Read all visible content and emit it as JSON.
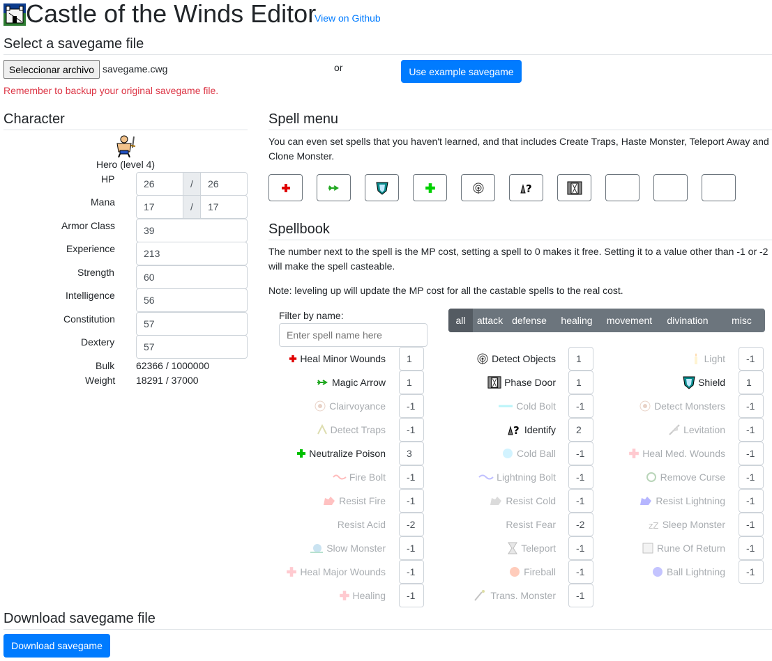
{
  "header": {
    "title": "Castle of the Winds Editor",
    "github_link": "View on Github"
  },
  "savegame": {
    "heading": "Select a savegame file",
    "choose_button": "Seleccionar archivo",
    "file_name": "savegame.cwg",
    "or_text": "or",
    "example_button": "Use example savegame",
    "warning": "Remember to backup your original savegame file."
  },
  "character": {
    "heading": "Character",
    "name": "Hero (level 4)",
    "hp_label": "HP",
    "hp_current": "26",
    "hp_max": "26",
    "mana_label": "Mana",
    "mana_current": "17",
    "mana_max": "17",
    "slash": "/",
    "armor_label": "Armor Class",
    "armor": "39",
    "experience_label": "Experience",
    "experience": "213",
    "strength_label": "Strength",
    "strength": "60",
    "intelligence_label": "Intelligence",
    "intelligence": "56",
    "constitution_label": "Constitution",
    "constitution": "57",
    "dexterity_label": "Dextery",
    "dexterity": "57",
    "bulk_label": "Bulk",
    "bulk": "62366 / 1000000",
    "weight_label": "Weight",
    "weight": "18291 / 37000"
  },
  "spell_menu": {
    "heading": "Spell menu",
    "desc": "You can even set spells that you haven't learned, and that includes Create Traps, Haste Monster, Teleport Away and Clone Monster.",
    "slots": [
      "heal-minor-icon",
      "magic-arrow-icon",
      "shield-icon",
      "neutralize-poison-icon",
      "detect-objects-icon",
      "identify-icon",
      "phase-door-icon",
      "",
      "",
      ""
    ]
  },
  "spellbook": {
    "heading": "Spellbook",
    "desc1": "The number next to the spell is the MP cost, setting a spell to 0 makes it free. Setting it to a value other than -1 or -2 will make the spell casteable.",
    "desc2": "Note: leveling up will update the MP cost for all the castable spells to the real cost.",
    "filter_label": "Filter by name:",
    "filter_placeholder": "Enter spell name here",
    "categories": [
      "all",
      "attack",
      "defense",
      "healing",
      "movement",
      "divination",
      "misc"
    ],
    "spells": [
      [
        {
          "name": "Heal Minor Wounds",
          "cost": "1",
          "learned": true,
          "icon": "red-cross-icon"
        },
        {
          "name": "Magic Arrow",
          "cost": "1",
          "learned": true,
          "icon": "magic-arrow-icon"
        },
        {
          "name": "Clairvoyance",
          "cost": "-1",
          "learned": false,
          "icon": "eye-icon"
        },
        {
          "name": "Detect Traps",
          "cost": "-1",
          "learned": false,
          "icon": "trap-icon"
        },
        {
          "name": "Neutralize Poison",
          "cost": "3",
          "learned": true,
          "icon": "green-cross-icon"
        },
        {
          "name": "Fire Bolt",
          "cost": "-1",
          "learned": false,
          "icon": "fire-bolt-icon"
        },
        {
          "name": "Resist Fire",
          "cost": "-1",
          "learned": false,
          "icon": "resist-fire-icon"
        },
        {
          "name": "Resist Acid",
          "cost": "-2",
          "learned": false,
          "icon": ""
        },
        {
          "name": "Slow Monster",
          "cost": "-1",
          "learned": false,
          "icon": "snail-icon"
        },
        {
          "name": "Heal Major Wounds",
          "cost": "-1",
          "learned": false,
          "icon": "pink-cross-icon"
        },
        {
          "name": "Healing",
          "cost": "-1",
          "learned": false,
          "icon": "pink-cross-icon"
        }
      ],
      [
        {
          "name": "Detect Objects",
          "cost": "1",
          "learned": true,
          "icon": "radar-icon"
        },
        {
          "name": "Phase Door",
          "cost": "1",
          "learned": true,
          "icon": "door-icon"
        },
        {
          "name": "Cold Bolt",
          "cost": "-1",
          "learned": false,
          "icon": "cold-bolt-icon"
        },
        {
          "name": "Identify",
          "cost": "2",
          "learned": true,
          "icon": "identify-icon"
        },
        {
          "name": "Cold Ball",
          "cost": "-1",
          "learned": false,
          "icon": "snowflake-icon"
        },
        {
          "name": "Lightning Bolt",
          "cost": "-1",
          "learned": false,
          "icon": "lightning-bolt-icon"
        },
        {
          "name": "Resist Cold",
          "cost": "-1",
          "learned": false,
          "icon": "resist-cold-icon"
        },
        {
          "name": "Resist Fear",
          "cost": "-2",
          "learned": false,
          "icon": ""
        },
        {
          "name": "Teleport",
          "cost": "-1",
          "learned": false,
          "icon": "hourglass-icon"
        },
        {
          "name": "Fireball",
          "cost": "-1",
          "learned": false,
          "icon": "fireball-icon"
        },
        {
          "name": "Trans. Monster",
          "cost": "-1",
          "learned": false,
          "icon": "wand-icon"
        }
      ],
      [
        {
          "name": "Light",
          "cost": "-1",
          "learned": false,
          "icon": "candle-icon"
        },
        {
          "name": "Shield",
          "cost": "1",
          "learned": true,
          "icon": "shield-icon"
        },
        {
          "name": "Detect Monsters",
          "cost": "-1",
          "learned": false,
          "icon": "eye-icon"
        },
        {
          "name": "Levitation",
          "cost": "-1",
          "learned": false,
          "icon": "feather-icon"
        },
        {
          "name": "Heal Med. Wounds",
          "cost": "-1",
          "learned": false,
          "icon": "pink-cross-icon"
        },
        {
          "name": "Remove Curse",
          "cost": "-1",
          "learned": false,
          "icon": "remove-curse-icon"
        },
        {
          "name": "Resist Lightning",
          "cost": "-1",
          "learned": false,
          "icon": "resist-lightning-icon"
        },
        {
          "name": "Sleep Monster",
          "cost": "-1",
          "learned": false,
          "icon": "sleep-icon"
        },
        {
          "name": "Rune Of Return",
          "cost": "-1",
          "learned": false,
          "icon": "rune-icon"
        },
        {
          "name": "Ball Lightning",
          "cost": "-1",
          "learned": false,
          "icon": "ball-lightning-icon"
        }
      ]
    ]
  },
  "download": {
    "heading": "Download savegame file",
    "button": "Download savegame"
  },
  "colors": {
    "primary": "#007bff",
    "danger": "#dc3545",
    "secondary": "#6c757d",
    "faded_text": "#a9adb1"
  }
}
